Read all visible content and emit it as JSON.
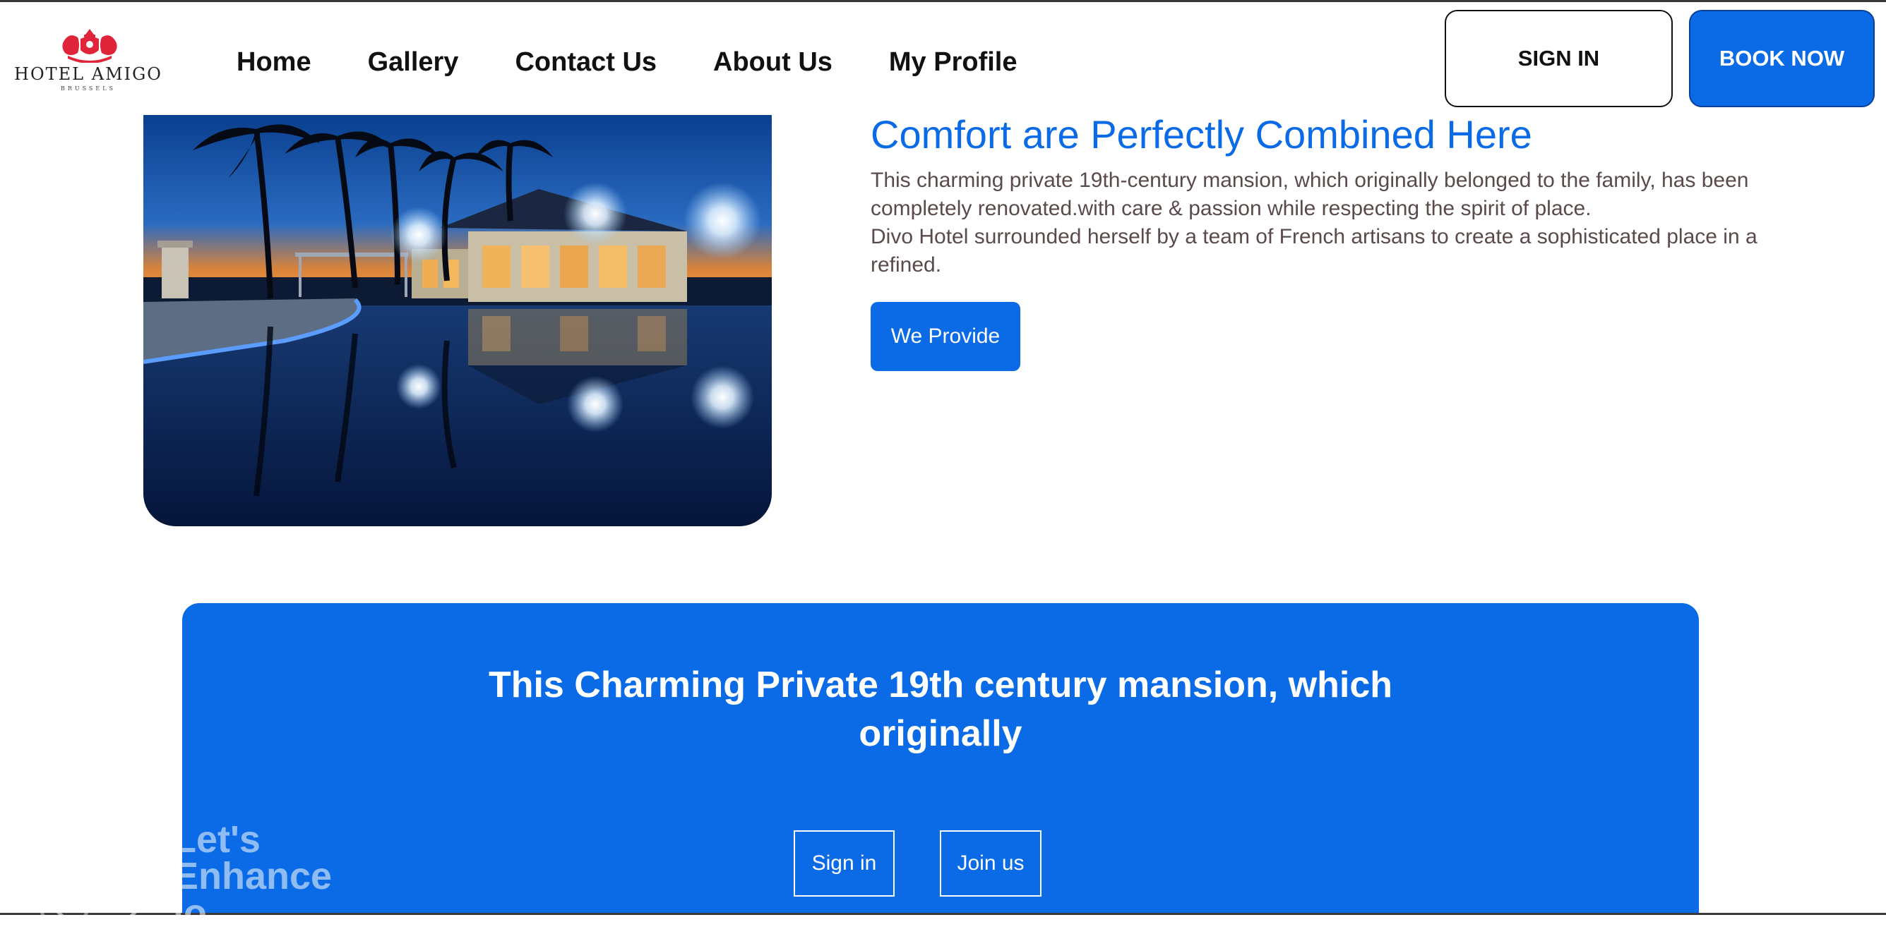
{
  "brand": {
    "name": "HOTEL AMIGO",
    "tagline": "BRUSSELS",
    "crest_color": "#e0243a"
  },
  "nav": {
    "items": [
      {
        "label": "Home"
      },
      {
        "label": "Gallery"
      },
      {
        "label": "Contact Us"
      },
      {
        "label": "About Us"
      },
      {
        "label": "My Profile"
      }
    ]
  },
  "header_actions": {
    "sign_in_label": "SIGN IN",
    "book_now_label": "BOOK NOW"
  },
  "hero": {
    "title": "Comfort are Perfectly Combined Here",
    "paragraph_1": "This charming private 19th-century mansion, which originally belonged to the family, has been completely renovated.with care & passion while respecting the spirit of place.",
    "paragraph_2": "Divo Hotel surrounded herself by a team of French artisans to create a sophisticated place in a refined.",
    "button_label": "We Provide"
  },
  "cta": {
    "heading_line_1": "This Charming Private 19th century mansion, which",
    "heading_line_2": "originally",
    "sign_in_label": "Sign in",
    "join_label": "Join us"
  },
  "watermark": {
    "line_1": "Let's",
    "line_2": "Enhance",
    "line_3": "io"
  },
  "colors": {
    "accent_blue": "#0b6ae6",
    "text_dark": "#111111",
    "body_text": "#5b4a4a"
  }
}
